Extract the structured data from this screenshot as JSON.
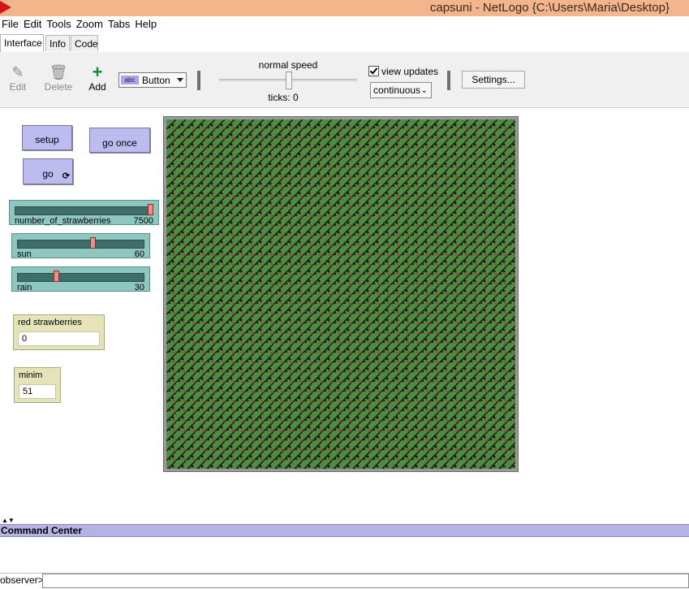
{
  "window": {
    "title": "capsuni - NetLogo {C:\\Users\\Maria\\Desktop}"
  },
  "menu": [
    "File",
    "Edit",
    "Tools",
    "Zoom",
    "Tabs",
    "Help"
  ],
  "tabs": {
    "interface": "Interface",
    "info": "Info",
    "code": "Code"
  },
  "toolbar": {
    "edit": "Edit",
    "delete": "Delete",
    "add": "Add",
    "widget_type": "Button",
    "widget_icon_text": "abc",
    "speed_label": "normal speed",
    "speed_fraction": 0.5,
    "ticks": "ticks: 0",
    "view_updates_label": "view updates",
    "view_updates_checked": true,
    "update_mode": "continuous",
    "settings": "Settings..."
  },
  "widgets": {
    "setup": "setup",
    "go_once": "go once",
    "go": "go",
    "sliders": [
      {
        "name": "number_of_strawberries",
        "value": "7500",
        "fraction": 1.0
      },
      {
        "name": "sun",
        "value": "60",
        "fraction": 0.6
      },
      {
        "name": "rain",
        "value": "30",
        "fraction": 0.3
      }
    ],
    "monitors": [
      {
        "name": "red strawberries",
        "value": "0"
      },
      {
        "name": "minim",
        "value": "51"
      }
    ]
  },
  "command_center": {
    "title": "Command Center",
    "prompt": "observer>"
  },
  "colors": {
    "button": "#bcbcf0",
    "slider": "#8ec6c0",
    "monitor": "#e4e4b8",
    "world_green": "#4c8d40",
    "title_bar": "#f3b68c"
  }
}
